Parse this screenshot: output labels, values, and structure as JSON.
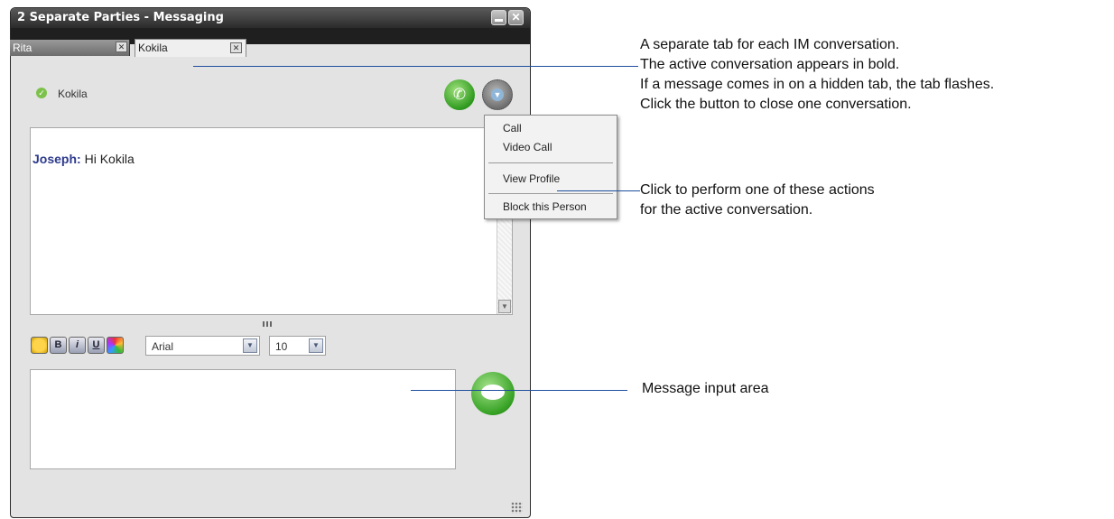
{
  "window": {
    "title": "2 Separate Parties - Messaging",
    "minimize_icon": "minimize-icon",
    "close_label": "✕"
  },
  "tabs": [
    {
      "label": "Rita",
      "close_label": "✕",
      "active": false
    },
    {
      "label": "Kokila",
      "close_label": "✕",
      "active": true
    }
  ],
  "contact": {
    "name": "Kokila",
    "status_icon": "check-icon",
    "status_color": "#7cc24a"
  },
  "actions": {
    "call_icon": "phone-icon",
    "menu_icon": "dropdown-icon"
  },
  "chat": {
    "messages": [
      {
        "sender": "Joseph:",
        "text": "Hi Kokila"
      }
    ]
  },
  "formatting": {
    "font": "Arial",
    "size": "10",
    "buttons": {
      "bold": "B",
      "italic": "i",
      "underline": "U"
    }
  },
  "context_menu": {
    "items": [
      "Call",
      "Video Call",
      "View Profile",
      "Block this Person"
    ]
  },
  "callouts": {
    "tabs": [
      "A separate tab for each IM conversation.",
      "The active conversation appears in bold.",
      "If a message comes in on a hidden tab, the tab flashes.",
      "Click the button to close one conversation."
    ],
    "actions": [
      "Click to perform one of these actions",
      "for the active conversation."
    ],
    "input": "Message input area"
  },
  "colors": {
    "accent_line": "#1f4e9e",
    "sender": "#2d3a8c",
    "call_green": "#2e9a1e"
  }
}
